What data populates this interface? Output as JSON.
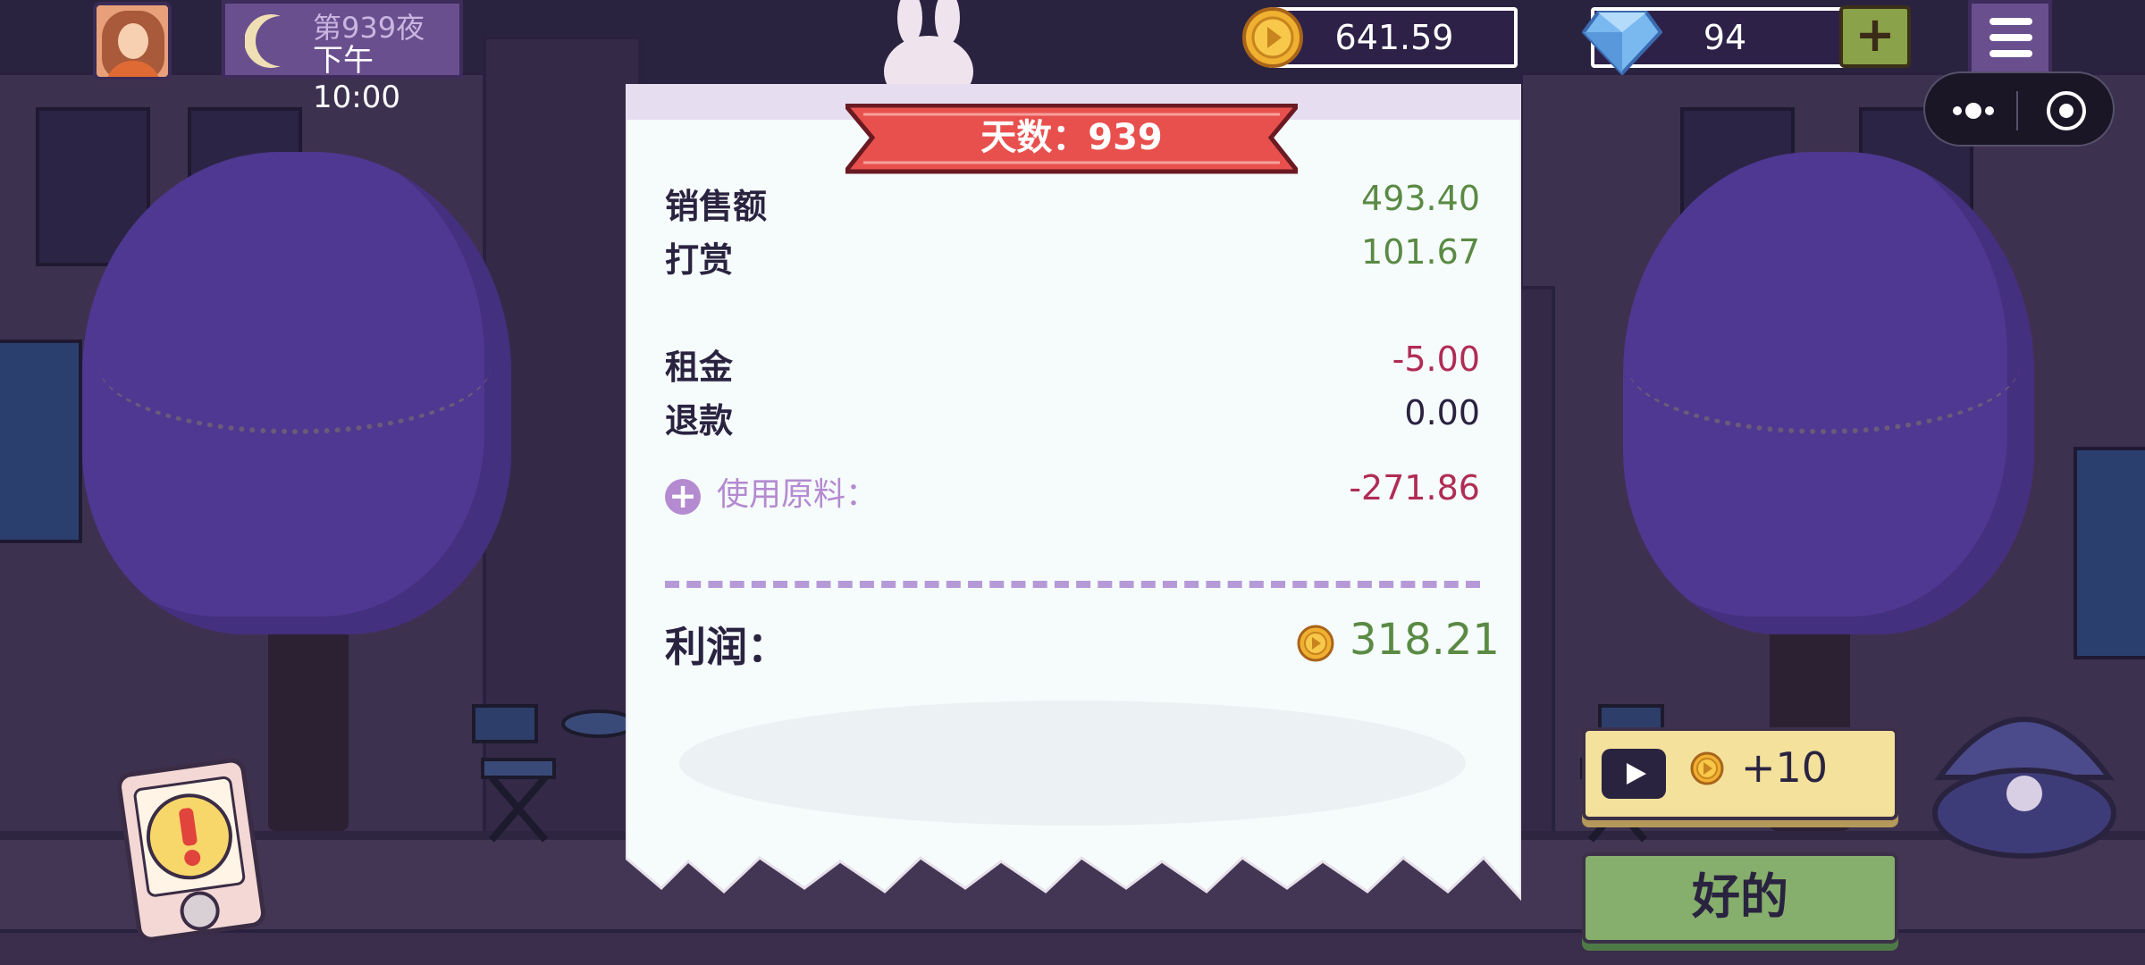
{
  "hud": {
    "day_label": "第939夜",
    "time_label": "下午10:00",
    "coins": "641.59",
    "gems": "94",
    "add_gems": "+"
  },
  "receipt": {
    "banner": "天数：939",
    "rows": [
      {
        "label": "销售额",
        "value": "493.40"
      },
      {
        "label": "打赏",
        "value": "101.67"
      },
      {
        "label": "租金",
        "value": "-5.00"
      },
      {
        "label": "退款",
        "value": "0.00"
      }
    ],
    "materials_label": "使用原料：",
    "materials_value": "-271.86",
    "profit_label": "利润：",
    "profit_value": "318.21"
  },
  "buttons": {
    "ad_reward": "+10",
    "ok": "好的"
  },
  "colors": {
    "positive": "#5a8a44",
    "negative": "#b02c54",
    "banner": "#e8504e"
  }
}
